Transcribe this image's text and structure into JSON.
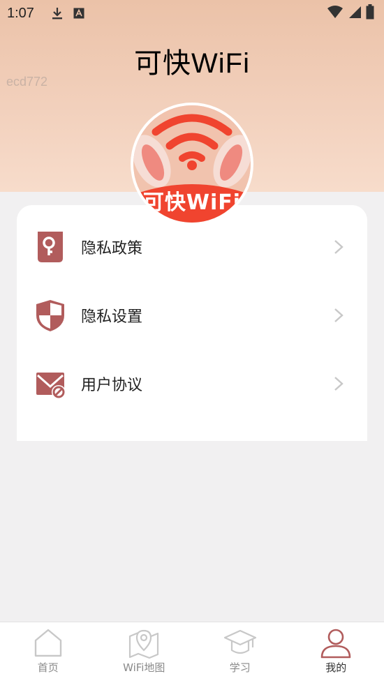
{
  "status_bar": {
    "time": "1:07",
    "icons": [
      "download-icon",
      "text-a-icon",
      "wifi-signal-icon",
      "cell-signal-icon",
      "battery-icon"
    ]
  },
  "header": {
    "title": "可快WiFi",
    "device_id": "ecd772"
  },
  "logo": {
    "text": "可快WiFi",
    "wifi_color": "#f0442f",
    "ear_color": "#f6ddd5"
  },
  "menu": {
    "items": [
      {
        "label": "隐私政策",
        "icon": "key-document-icon"
      },
      {
        "label": "隐私设置",
        "icon": "shield-icon"
      },
      {
        "label": "用户协议",
        "icon": "mail-blocked-icon"
      }
    ]
  },
  "tabbar": {
    "tabs": [
      {
        "label": "首页",
        "icon": "home-icon",
        "active": false
      },
      {
        "label": "WiFi地图",
        "icon": "map-pin-icon",
        "active": false
      },
      {
        "label": "学习",
        "icon": "graduation-cap-icon",
        "active": false
      },
      {
        "label": "我的",
        "icon": "user-icon",
        "active": true
      }
    ]
  },
  "colors": {
    "accent": "#b15c5c",
    "icon_gray": "#c8c8c8",
    "header_top": "#ebc2a8",
    "header_bottom": "#f7dccb"
  }
}
